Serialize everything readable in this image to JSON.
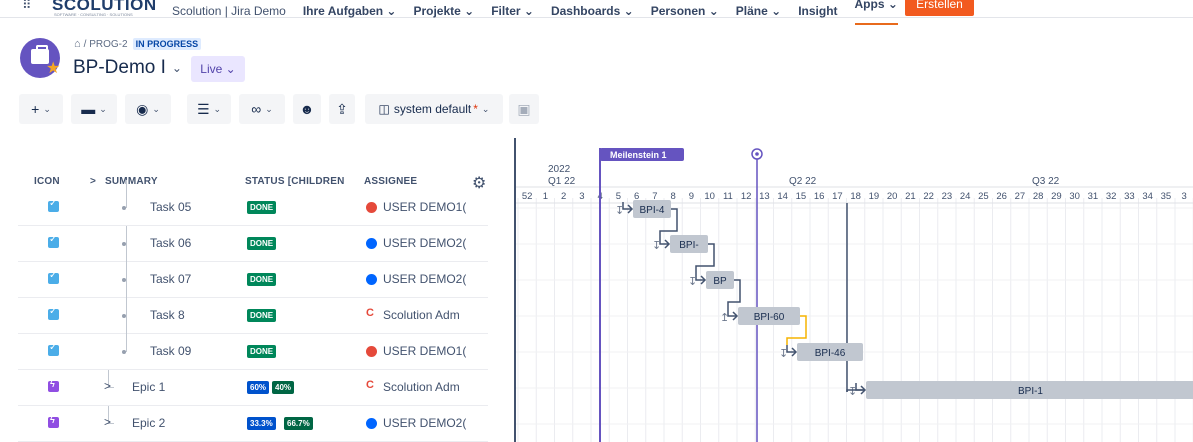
{
  "topnav": {
    "logo_text": "SCOLUTION",
    "logo_sub": "SOFTWARE · CONSULTING · SOLUTIONS",
    "items": [
      "Scolution | Jira Demo",
      "Ihre Aufgaben ⌄",
      "Projekte ⌄",
      "Filter ⌄",
      "Dashboards ⌄",
      "Personen ⌄",
      "Pläne ⌄",
      "Insight",
      "Apps ⌄"
    ],
    "create_label": "Erstellen",
    "apps_icon": "grid-icon"
  },
  "header": {
    "breadcrumb_text": "/ PROG-2",
    "status": "IN PROGRESS",
    "title": "BP-Demo I",
    "title_chevron": "⌄",
    "live_label": "Live ⌄"
  },
  "toolbar": {
    "view_label": "system default",
    "view_modified": "*"
  },
  "grid": {
    "headers": {
      "icon": "ICON",
      "summary": "SUMMARY",
      "status": "STATUS [CHILDREN",
      "assignee": "ASSIGNEE"
    },
    "rows": [
      {
        "type": "task",
        "name": "Task 05",
        "status": "DONE",
        "assignee": "USER DEMO1(",
        "avatar": "red"
      },
      {
        "type": "task",
        "name": "Task 06",
        "status": "DONE",
        "assignee": "USER DEMO2(",
        "avatar": "blue"
      },
      {
        "type": "task",
        "name": "Task 07",
        "status": "DONE",
        "assignee": "USER DEMO2(",
        "avatar": "blue"
      },
      {
        "type": "task",
        "name": "Task 8",
        "status": "DONE",
        "assignee": "Scolution Adm",
        "avatar": "c"
      },
      {
        "type": "task",
        "name": "Task 09",
        "status": "DONE",
        "assignee": "USER DEMO1(",
        "avatar": "red"
      },
      {
        "type": "epic",
        "name": "Epic 1",
        "progress": [
          "60%",
          "40%"
        ],
        "assignee": "Scolution Adm",
        "avatar": "c"
      },
      {
        "type": "epic",
        "name": "Epic 2",
        "progress": [
          "33.3%",
          "66.7%"
        ],
        "assignee": "USER DEMO2(",
        "avatar": "blue"
      }
    ]
  },
  "gantt": {
    "milestone_label": "Meilenstein 1",
    "year": "2022",
    "quarters": [
      "Q1 22",
      "Q2 22",
      "Q3 22"
    ],
    "weeks": [
      "52",
      "1",
      "2",
      "3",
      "4",
      "5",
      "6",
      "7",
      "8",
      "9",
      "10",
      "11",
      "12",
      "13",
      "14",
      "15",
      "16",
      "17",
      "18",
      "19",
      "20",
      "21",
      "22",
      "23",
      "24",
      "25",
      "26",
      "27",
      "28",
      "29",
      "30",
      "31",
      "32",
      "33",
      "34",
      "35",
      "3"
    ],
    "bars": [
      "BPI-4",
      "BPI-",
      "BP",
      "BPI-60",
      "BPI-46",
      "BPI-1"
    ],
    "colors": {
      "milestone": "#6554c0",
      "bar": "#c1c7d0",
      "critical": "#f5b400",
      "link": "#42526e"
    }
  }
}
